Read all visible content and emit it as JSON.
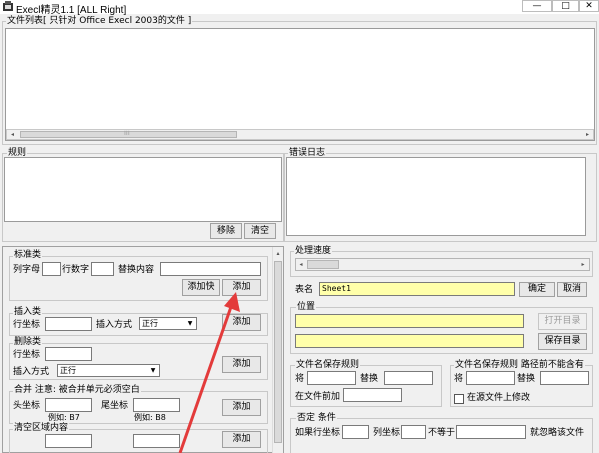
{
  "window": {
    "title": "Execl精灵1.1   [ALL Right]",
    "btn_min": "—",
    "btn_max": "□",
    "btn_close": "✕"
  },
  "file_list": {
    "legend": "文件列表[ 只针对 Office Execl 2003的文件 ]",
    "scroll_left": "◂",
    "scroll_right": "▸",
    "grip": "⁞⁞⁞"
  },
  "rules": {
    "legend": "规则",
    "remove_label": "移除",
    "clear_label": "清空"
  },
  "error_log": {
    "legend": "错误日志"
  },
  "standard": {
    "legend": "标准类",
    "col_letter_label": "列字母",
    "row_number_label": "行数字",
    "replace_label": "替换内容",
    "add_fast_label": "添加快",
    "add_label": "添加"
  },
  "insert": {
    "legend": "插入类",
    "row_label": "行坐标",
    "mode_label": "插入方式",
    "mode_value": "正行",
    "add_label": "添加"
  },
  "delete": {
    "legend": "删除类",
    "row_label": "行坐标",
    "mode_label": "插入方式",
    "mode_value": "正行",
    "add_label": "添加"
  },
  "merge": {
    "legend": "合并  注意: 被合并单元必须空白",
    "head_label": "头坐标",
    "head_example": "例如: B7",
    "tail_label": "尾坐标",
    "tail_example": "例如: B8",
    "add_label": "添加"
  },
  "clear_area": {
    "legend": "清空区域内容",
    "add_label": "添加"
  },
  "progress": {
    "legend": "处理速度",
    "percent": 0.12
  },
  "sheet": {
    "label": "表名",
    "value": "Sheet1",
    "ok_label": "确定",
    "cancel_label": "取消"
  },
  "position": {
    "legend": "位置",
    "open_dir_label": "打开目录",
    "save_dir_label": "保存目录"
  },
  "save_rule": {
    "legend": "文件名保存规则",
    "to_label": "将",
    "replace_label": "替换",
    "prefix_label": "在文件前加"
  },
  "save_rule_before": {
    "legend": "文件名保存规则  路径前不能含有",
    "to_label": "将",
    "replace_label": "替换",
    "modify_source_label": "在源文件上修改"
  },
  "negate": {
    "legend": "否定  条件",
    "if_row_label": "如果行坐标",
    "col_label": "列坐标",
    "not_equal_label": "不等于",
    "ignore_label": "就忽略该文件"
  },
  "scrollbar": {
    "up": "▴",
    "down": "▾"
  },
  "colors": {
    "yellow": "#ffffaa",
    "arrow": "#e33b3b"
  }
}
